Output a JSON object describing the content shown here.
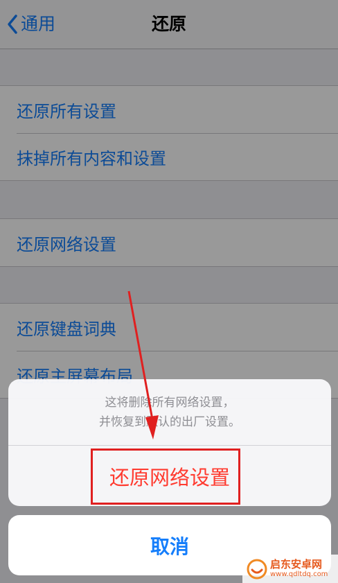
{
  "nav": {
    "back_label": "通用",
    "title": "还原"
  },
  "groups": [
    {
      "items": [
        "还原所有设置",
        "抹掉所有内容和设置"
      ]
    },
    {
      "items": [
        "还原网络设置"
      ]
    },
    {
      "items": [
        "还原键盘词典",
        "还原主屏幕布局"
      ]
    }
  ],
  "sheet": {
    "message_line1": "这将删除所有网络设置，",
    "message_line2": "并恢复到默认的出厂设置。",
    "action_label": "还原网络设置",
    "cancel_label": "取消"
  },
  "watermark": {
    "name": "启东安卓网",
    "url": "www.qdltdq.com"
  },
  "colors": {
    "ios_blue": "#157efb",
    "destructive_red": "#ff3b30",
    "annotation_red": "#e02020"
  }
}
